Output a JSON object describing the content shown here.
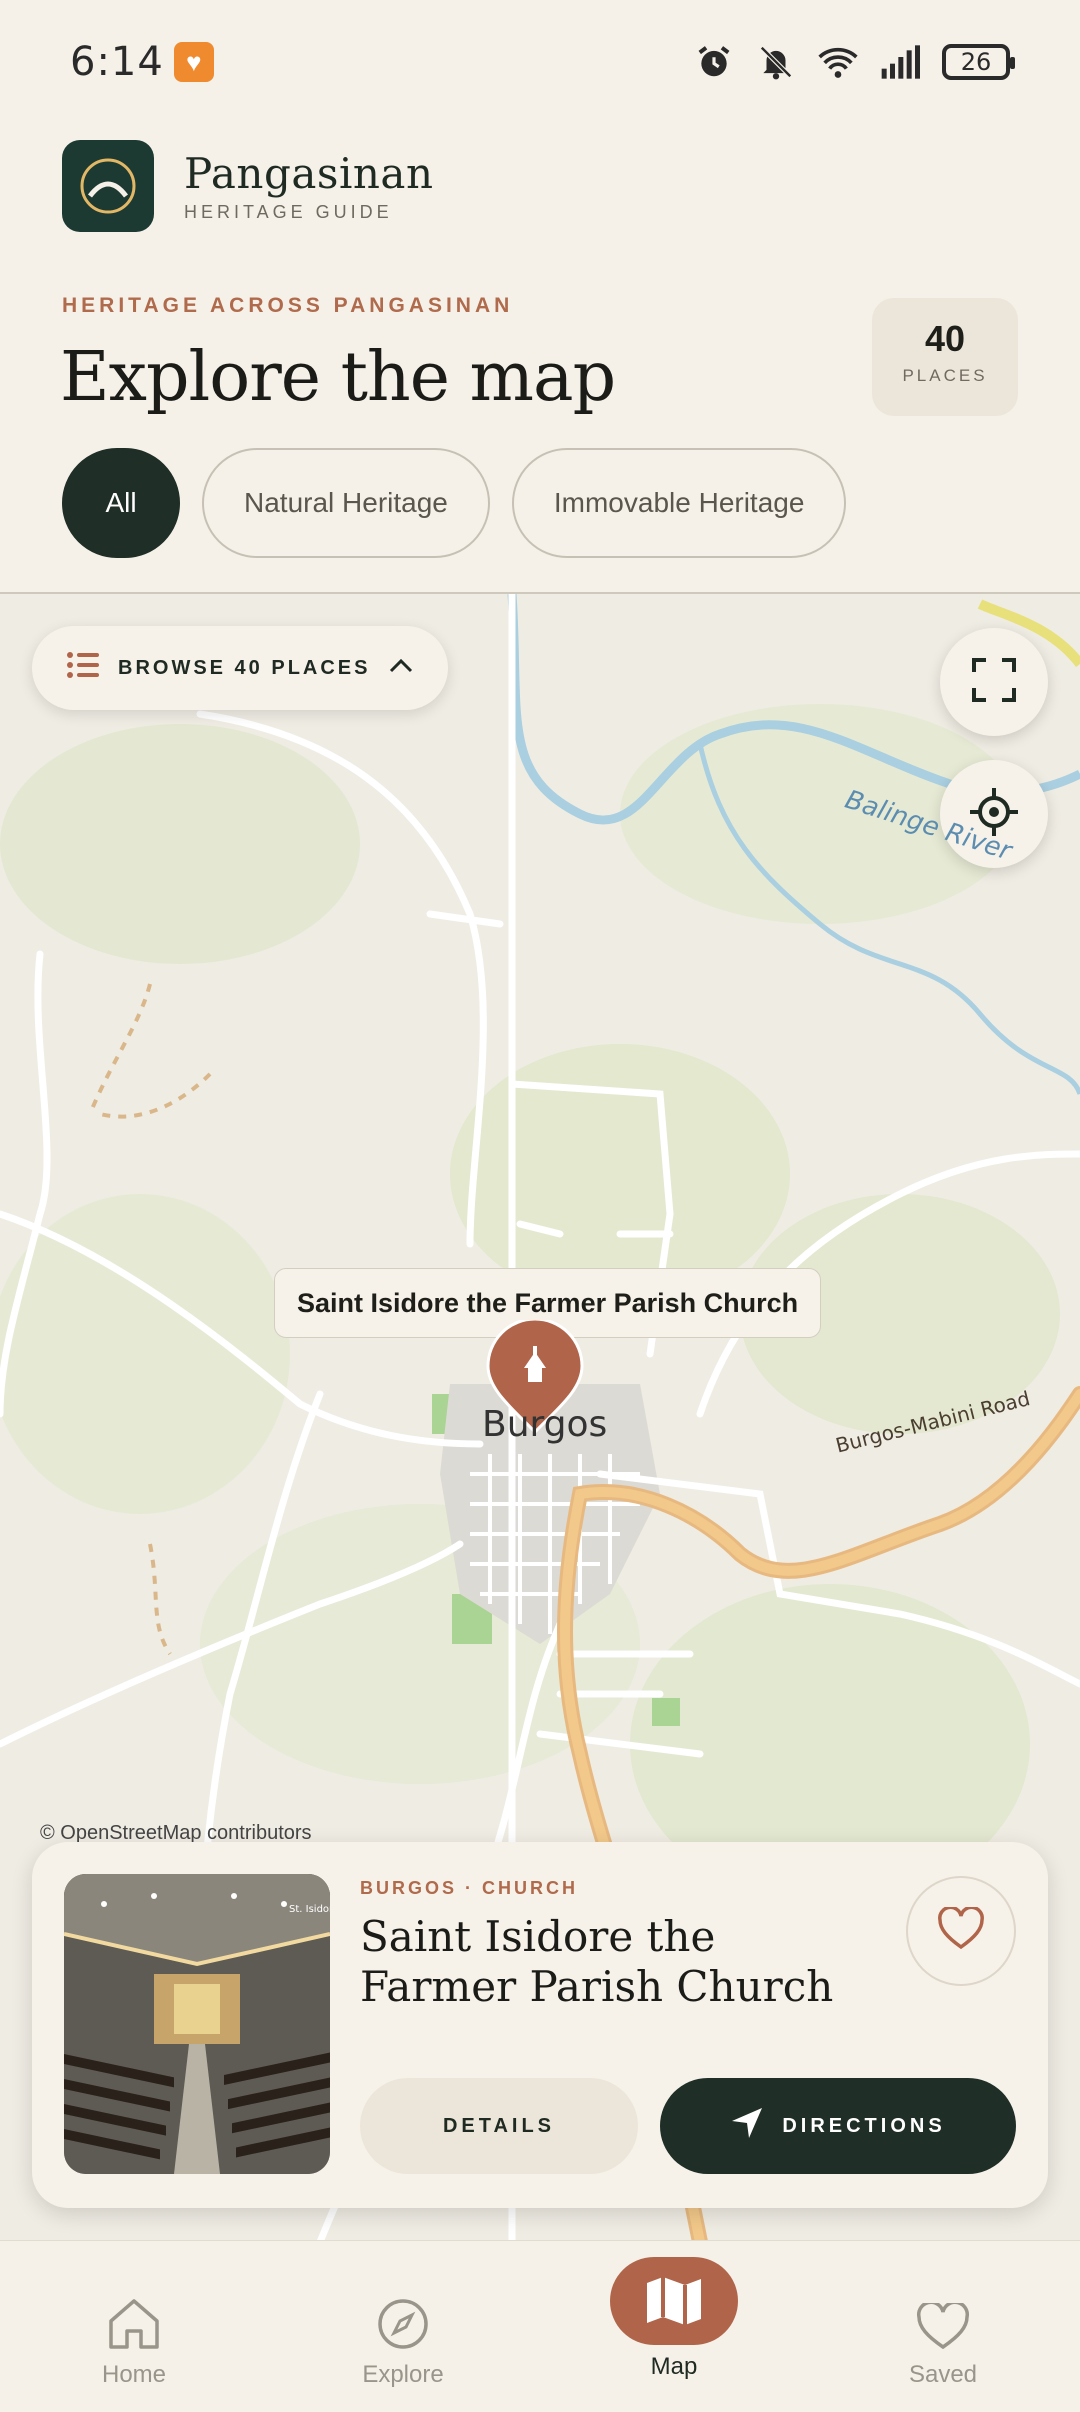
{
  "status_bar": {
    "time": "6:14",
    "battery": "26"
  },
  "app": {
    "name": "Pangasinan",
    "subtitle": "HERITAGE GUIDE"
  },
  "header": {
    "eyebrow": "HERITAGE ACROSS PANGASINAN",
    "title": "Explore the map",
    "places_count": "40",
    "places_label": "PLACES"
  },
  "filters": [
    {
      "label": "All",
      "active": true
    },
    {
      "label": "Natural Heritage",
      "active": false
    },
    {
      "label": "Immovable Heritage",
      "active": false
    }
  ],
  "map": {
    "browse_label": "BROWSE 40 PLACES",
    "tooltip": "Saint Isidore the Farmer Parish Church",
    "town_label": "Burgos",
    "road_label": "Burgos-Mabini Road",
    "river_label": "Balinge River",
    "attribution": "© OpenStreetMap contributors",
    "colors": {
      "pin": "#b0654a",
      "river": "#a9cfe0",
      "road_major": "#f2c98a"
    }
  },
  "place_card": {
    "eyebrow": "BURGOS · CHURCH",
    "title": "Saint Isidore the Farmer Parish Church",
    "details_label": "DETAILS",
    "directions_label": "DIRECTIONS",
    "photo_sign": "St. Isidore the Farmer"
  },
  "bottom_nav": [
    {
      "label": "Home",
      "icon": "home-icon",
      "active": false
    },
    {
      "label": "Explore",
      "icon": "compass-icon",
      "active": false
    },
    {
      "label": "Map",
      "icon": "map-icon",
      "active": true
    },
    {
      "label": "Saved",
      "icon": "heart-icon",
      "active": false
    }
  ],
  "colors": {
    "accent": "#b06a4c",
    "primary_dark": "#1f2e26",
    "background": "#f5f1e9"
  }
}
